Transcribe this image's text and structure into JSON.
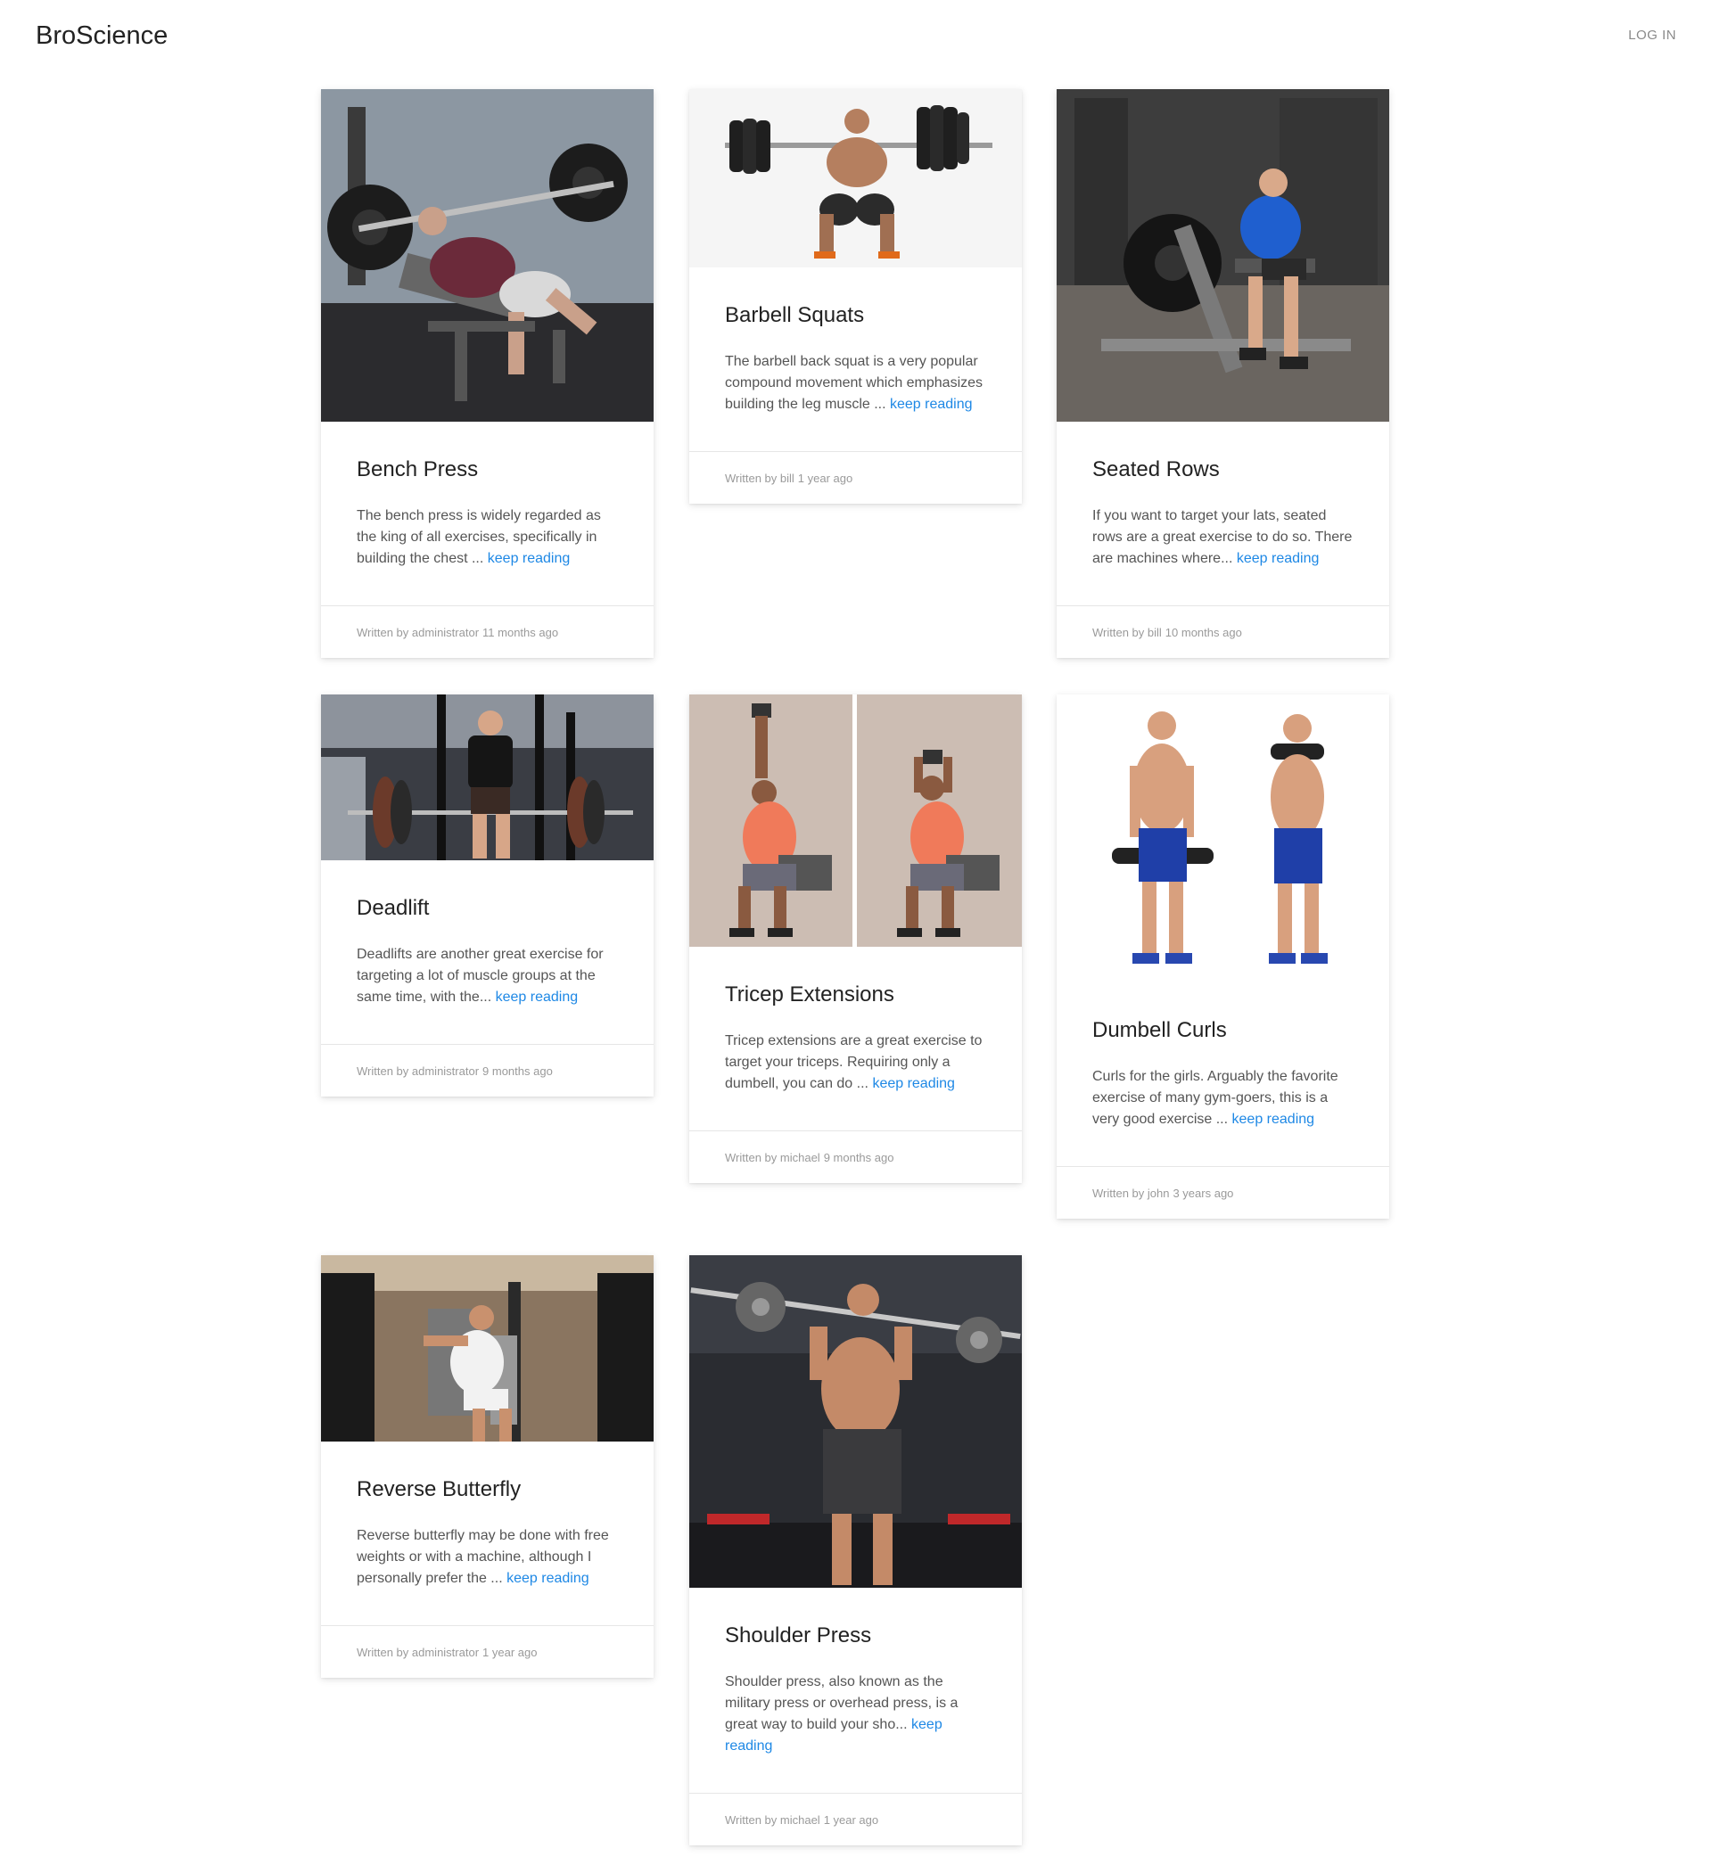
{
  "header": {
    "brand": "BroScience",
    "login": "LOG IN"
  },
  "cards": [
    {
      "title": "Bench Press",
      "excerpt": "The bench press is widely regarded as the king of all exercises, specifically in building the chest ...",
      "more": "keep reading",
      "written_by": "Written by administrator",
      "ago": "11 months ago",
      "image": "bench-press-photo"
    },
    {
      "title": "Barbell Squats",
      "excerpt": "The barbell back squat is a very popular compound movement which emphasizes building the leg muscle ...",
      "more": "keep reading",
      "written_by": "Written by bill",
      "ago": "1 year ago",
      "image": "barbell-squat-photo"
    },
    {
      "title": "Seated Rows",
      "excerpt": "If you want to target your lats, seated rows are a great exercise to do so. There are machines where...",
      "more": "keep reading",
      "written_by": "Written by bill",
      "ago": "10 months ago",
      "image": "seated-row-photo"
    },
    {
      "title": "Deadlift",
      "excerpt": "Deadlifts are another great exercise for targeting a lot of muscle groups at the same time, with the...",
      "more": "keep reading",
      "written_by": "Written by administrator",
      "ago": "9 months ago",
      "image": "deadlift-photo"
    },
    {
      "title": "Tricep Extensions",
      "excerpt": "Tricep extensions are a great exercise to target your triceps. Requiring only a dumbell, you can do ...",
      "more": "keep reading",
      "written_by": "Written by michael",
      "ago": "9 months ago",
      "image": "tricep-extension-photo"
    },
    {
      "title": "Dumbell Curls",
      "excerpt": "Curls for the girls. Arguably the favorite exercise of many gym-goers, this is a very good exercise ...",
      "more": "keep reading",
      "written_by": "Written by john",
      "ago": "3 years ago",
      "image": "dumbbell-curl-photo"
    },
    {
      "title": "Reverse Butterfly",
      "excerpt": "Reverse butterfly may be done with free weights or with a machine, although I personally prefer the ...",
      "more": "keep reading",
      "written_by": "Written by administrator",
      "ago": "1 year ago",
      "image": "reverse-butterfly-photo"
    },
    {
      "title": "Shoulder Press",
      "excerpt": "Shoulder press, also known as the military press or overhead press, is a great way to build your sho...",
      "more": "keep reading",
      "written_by": "Written by michael",
      "ago": "1 year ago",
      "image": "shoulder-press-photo"
    }
  ]
}
